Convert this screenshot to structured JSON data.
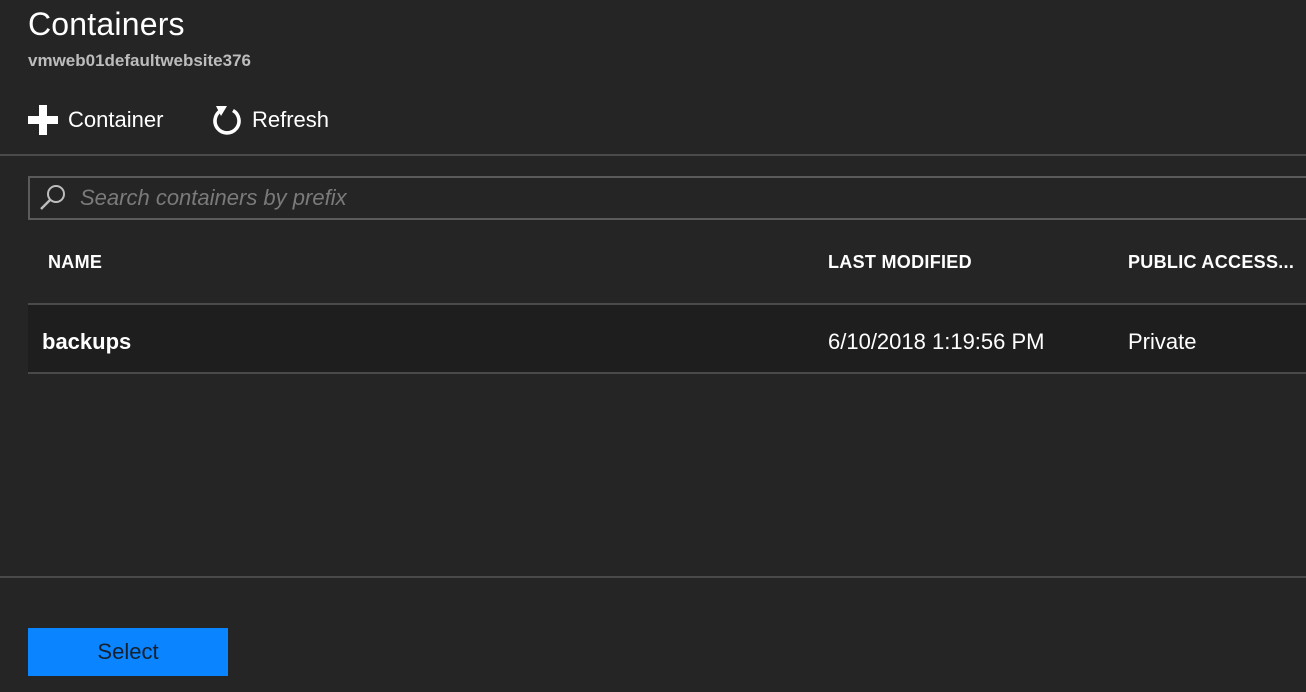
{
  "header": {
    "title": "Containers",
    "subtitle": "vmweb01defaultwebsite376"
  },
  "toolbar": {
    "add_label": "Container",
    "add_icon": "plus-icon",
    "refresh_label": "Refresh",
    "refresh_icon": "refresh-icon"
  },
  "search": {
    "placeholder": "Search containers by prefix",
    "value": "",
    "icon": "search-icon"
  },
  "table": {
    "columns": [
      "NAME",
      "LAST MODIFIED",
      "PUBLIC ACCESS..."
    ],
    "rows": [
      {
        "name": "backups",
        "last_modified": "6/10/2018 1:19:56 PM",
        "public_access": "Private"
      }
    ]
  },
  "footer": {
    "select_label": "Select"
  },
  "colors": {
    "background": "#252526",
    "row_background": "#1e1e1e",
    "accent": "#0a84ff"
  }
}
